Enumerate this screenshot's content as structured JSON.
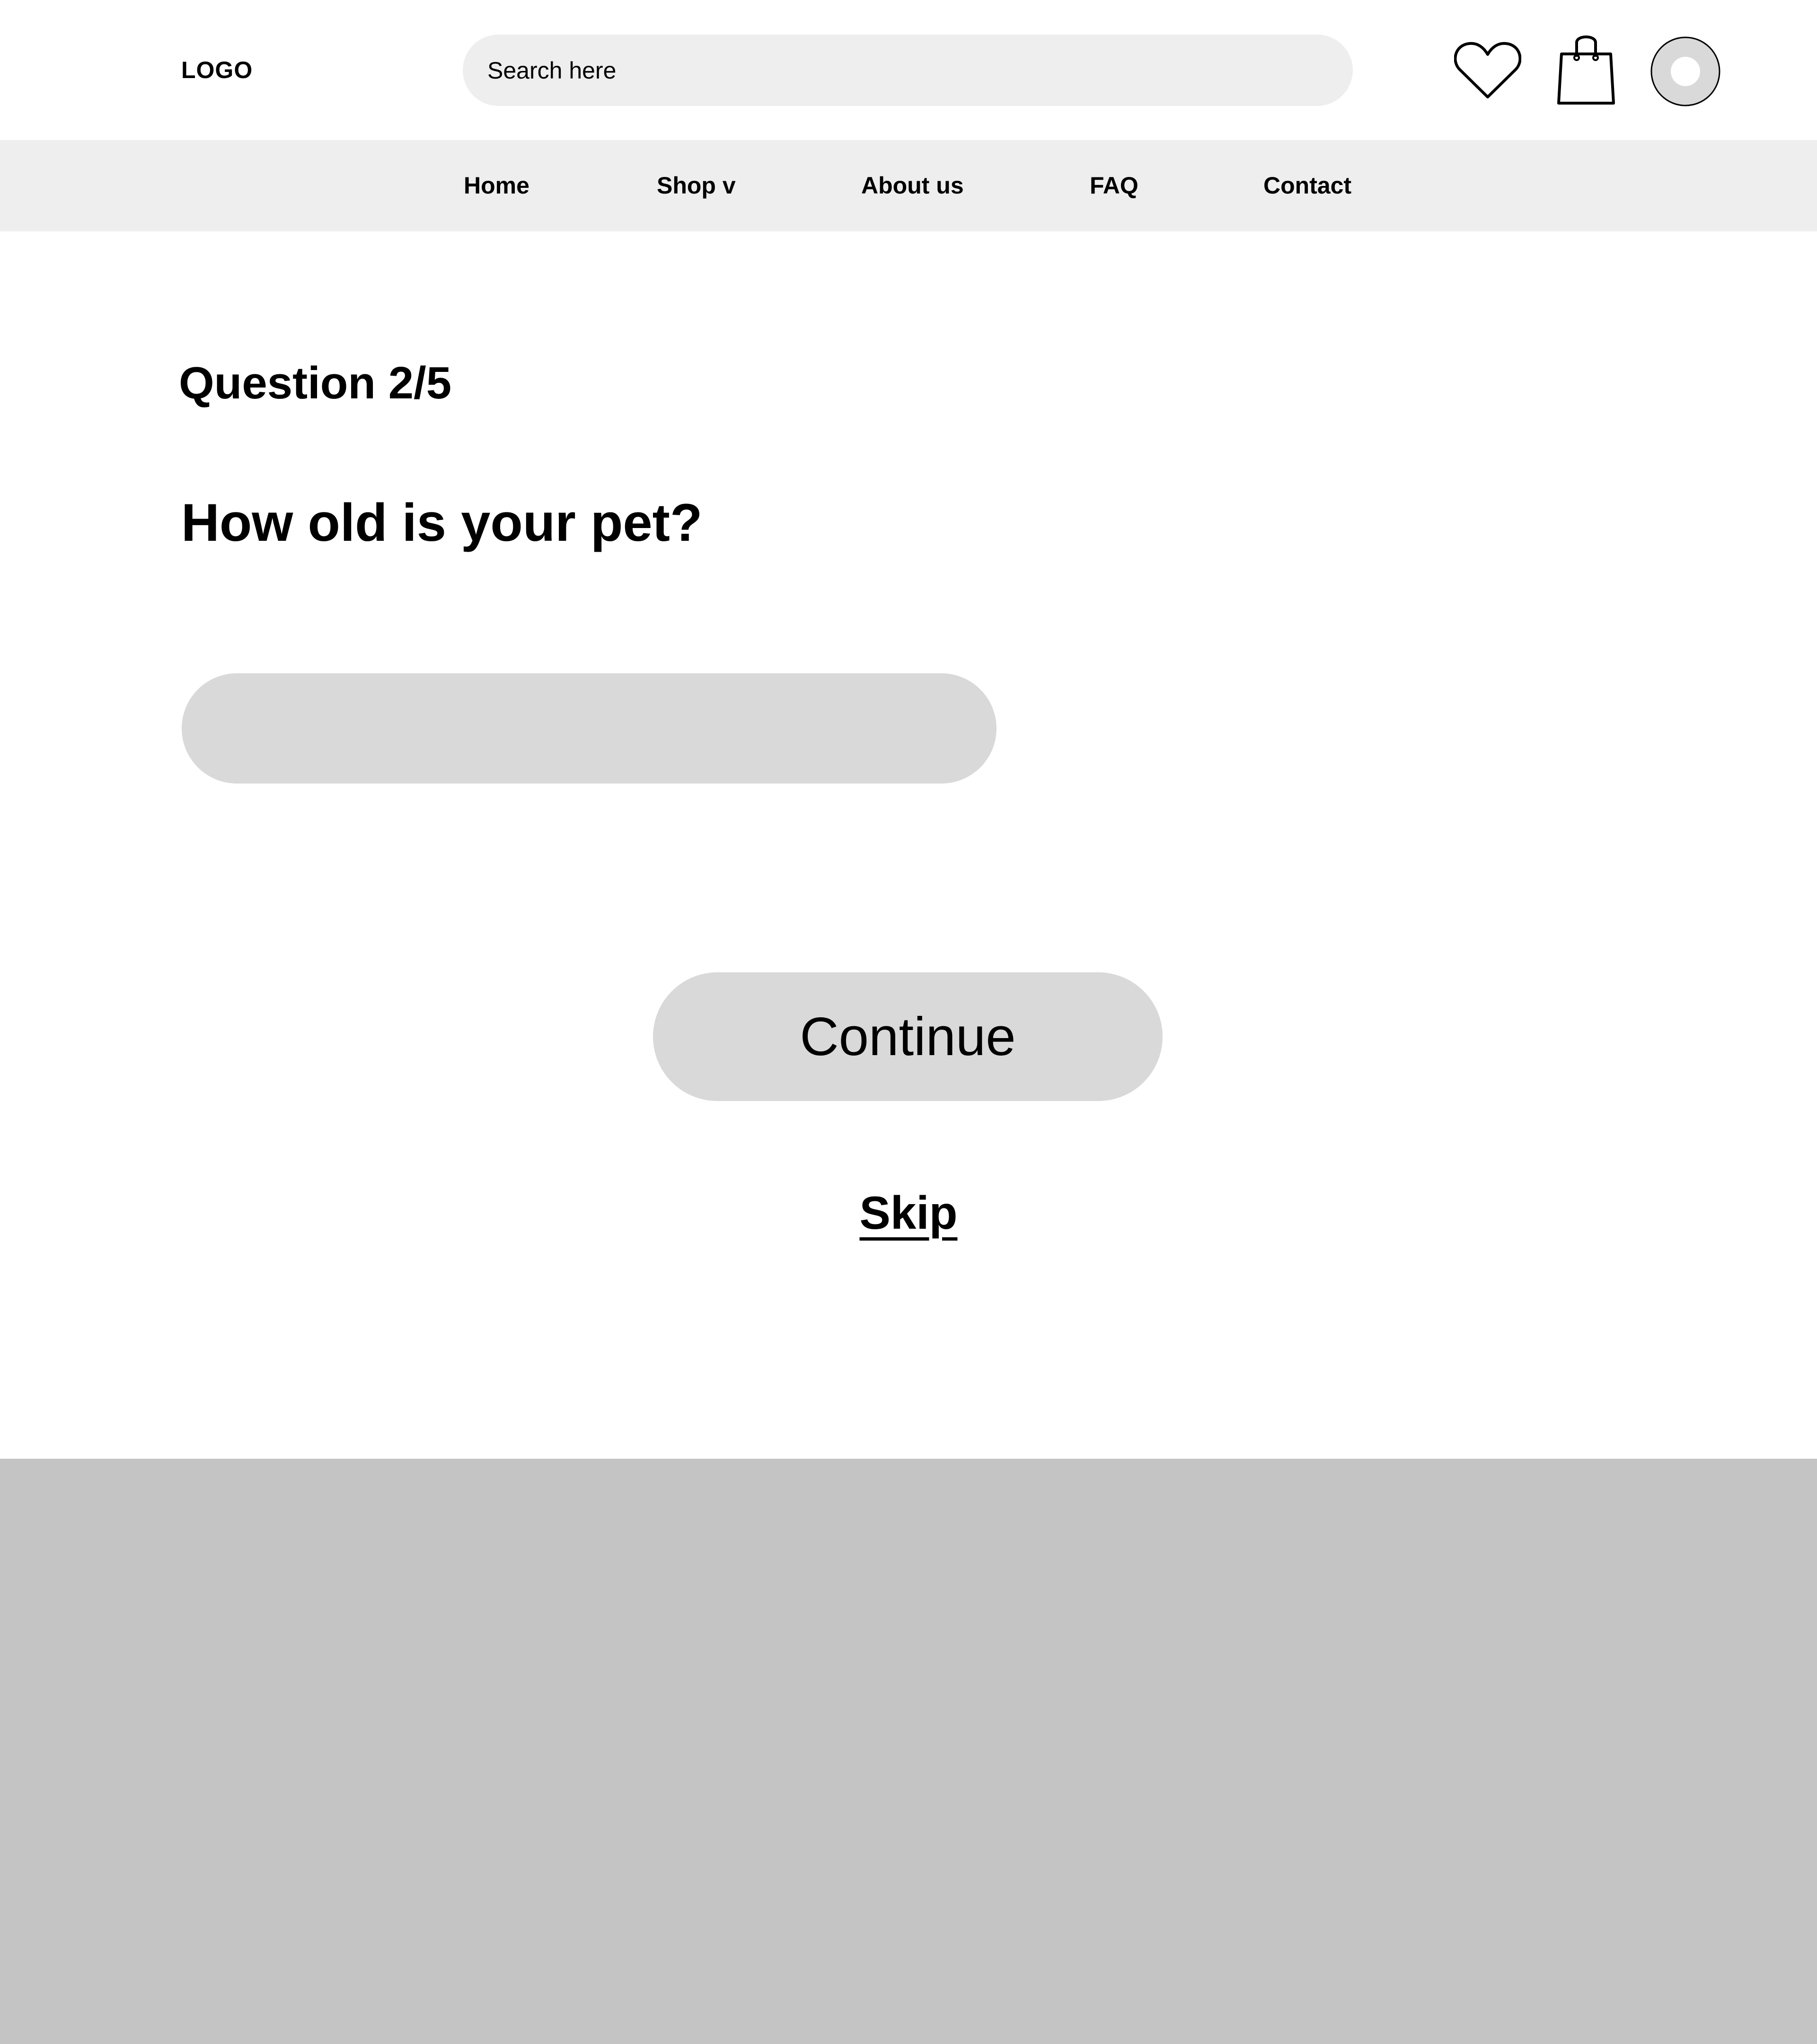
{
  "header": {
    "logo_text": "LOGO",
    "search": {
      "placeholder": "Search here",
      "value": ""
    },
    "icons": {
      "wishlist": "heart-icon",
      "cart": "shopping-bag-icon",
      "account": "user-avatar-icon"
    }
  },
  "nav": {
    "items": [
      {
        "label": "Home"
      },
      {
        "label": "Shop v"
      },
      {
        "label": "About us"
      },
      {
        "label": "FAQ"
      },
      {
        "label": "Contact"
      }
    ]
  },
  "quiz": {
    "progress_label": "Question 2/5",
    "current_question": 2,
    "total_questions": 5,
    "question": "How old is your pet?",
    "answer_value": "",
    "continue_label": "Continue",
    "skip_label": "Skip"
  },
  "colors": {
    "page_background": "#FFFFFF",
    "nav_background": "#EEEEEE",
    "search_background": "#EEEEEE",
    "control_background": "#D9D9D9",
    "footer_background": "#C4C4C4",
    "text": "#000000"
  }
}
